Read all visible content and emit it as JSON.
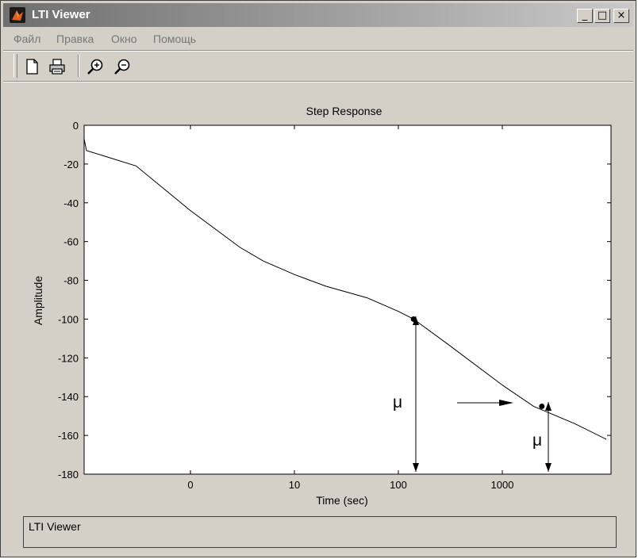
{
  "window": {
    "title": "LTI Viewer",
    "controls": {
      "minimize": "_",
      "maximize": "□",
      "close": "×"
    }
  },
  "menu": {
    "items": [
      {
        "label": "Файл"
      },
      {
        "label": "Правка"
      },
      {
        "label": "Окно"
      },
      {
        "label": "Помощь"
      }
    ]
  },
  "toolbar": {
    "icons": [
      "new-document-icon",
      "print-icon",
      "zoom-in-icon",
      "zoom-out-icon"
    ]
  },
  "status_bar": {
    "text": "LTI Viewer"
  },
  "annotations": {
    "mu_1": "μ",
    "mu_2": "μ"
  },
  "colors": {
    "window_bg": "#d4d0c8",
    "plot_bg": "#ffffff",
    "curve": "#000000"
  },
  "chart_data": {
    "type": "line",
    "title": "Step Response",
    "xlabel": "Time (sec)",
    "ylabel": "Amplitude",
    "x_scale": "log",
    "x_tick_labels": [
      "0",
      "10",
      "100",
      "1000"
    ],
    "y_tick_labels": [
      "0",
      "-20",
      "-40",
      "-60",
      "-80",
      "-100",
      "-120",
      "-140",
      "-160",
      "-180"
    ],
    "ylim": [
      -180,
      0
    ],
    "grid": false,
    "series": [
      {
        "x": [
          0.03,
          0.1,
          0.3,
          1,
          2,
          3,
          5,
          10,
          20,
          50,
          100,
          140,
          300,
          1000,
          2000,
          5000,
          10000
        ],
        "values": [
          -7,
          -13,
          -21,
          -44,
          -56,
          -63,
          -70,
          -77,
          -83,
          -89,
          -96,
          -100,
          -113,
          -134,
          -145,
          -154,
          -162
        ]
      }
    ],
    "markers": [
      {
        "x": 140,
        "y": -100
      },
      {
        "x": 2400,
        "y": -145
      }
    ]
  }
}
